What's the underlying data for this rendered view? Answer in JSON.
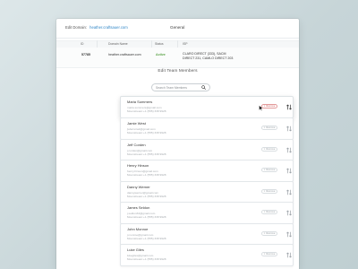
{
  "header": {
    "edit_domain_label": "Edit Domain:",
    "domain": "heather.craftsauer.com",
    "title": "General"
  },
  "summary": {
    "columns": [
      "ID",
      "Domain Name",
      "Status",
      "ISP"
    ],
    "row": {
      "id": "57785",
      "domain": "heather.craftsauer.com",
      "status": "Active",
      "isp_line1": "CLARO DIRECT (333), SACM",
      "isp_line2": "DIRECT 231, CAMLO DIRECT 203"
    }
  },
  "section": {
    "title": "Edit Team Members"
  },
  "search": {
    "placeholder": "Search Team Members"
  },
  "members": [
    {
      "name": "Maria Summers",
      "email": "maria.summers@gmail.com",
      "phone": "Moonstream:+1 (555) 338 9928",
      "remove_label": "Remove"
    },
    {
      "name": "Jamie West",
      "email": "jwferreira4@gmail.com",
      "phone": "Moonstream:+1 (555) 338 9928",
      "remove_label": "Remove"
    },
    {
      "name": "Jeff Corden",
      "email": "j.corden@gmail.com",
      "phone": "Moonstream:+1 (555) 338 9928",
      "remove_label": "Remove"
    },
    {
      "name": "Henry Hinson",
      "email": "henry.hinson@gmail.com",
      "phone": "Moonstream:+1 (555) 338 9928",
      "remove_label": "Remove"
    },
    {
      "name": "Danny Werner",
      "email": "dannywerner@gmail.com",
      "phone": "Moonstream:+1 (555) 338 9928",
      "remove_label": "Remove"
    },
    {
      "name": "James Seldon",
      "email": "j.seldon34@gmail.com",
      "phone": "Moonstream:+1 (555) 338 9928",
      "remove_label": "Remove"
    },
    {
      "name": "John Monroe",
      "email": "j.monroe@gmail.com",
      "phone": "Moonstream:+1 (555) 338 9928",
      "remove_label": "Remove"
    },
    {
      "name": "Luke Giles",
      "email": "lukegiles@gmail.com",
      "phone": "Moonstream:+1 (555) 338 9928",
      "remove_label": "Remove"
    }
  ],
  "active_member_index": 0,
  "colors": {
    "link": "#2f86c7",
    "status_active": "#5da44a",
    "remove_active": "#d15c5c"
  },
  "icons": {
    "search": "search-icon",
    "drag": "drag-handle-icon",
    "cursor": "cursor-icon",
    "remove": "close-icon"
  }
}
